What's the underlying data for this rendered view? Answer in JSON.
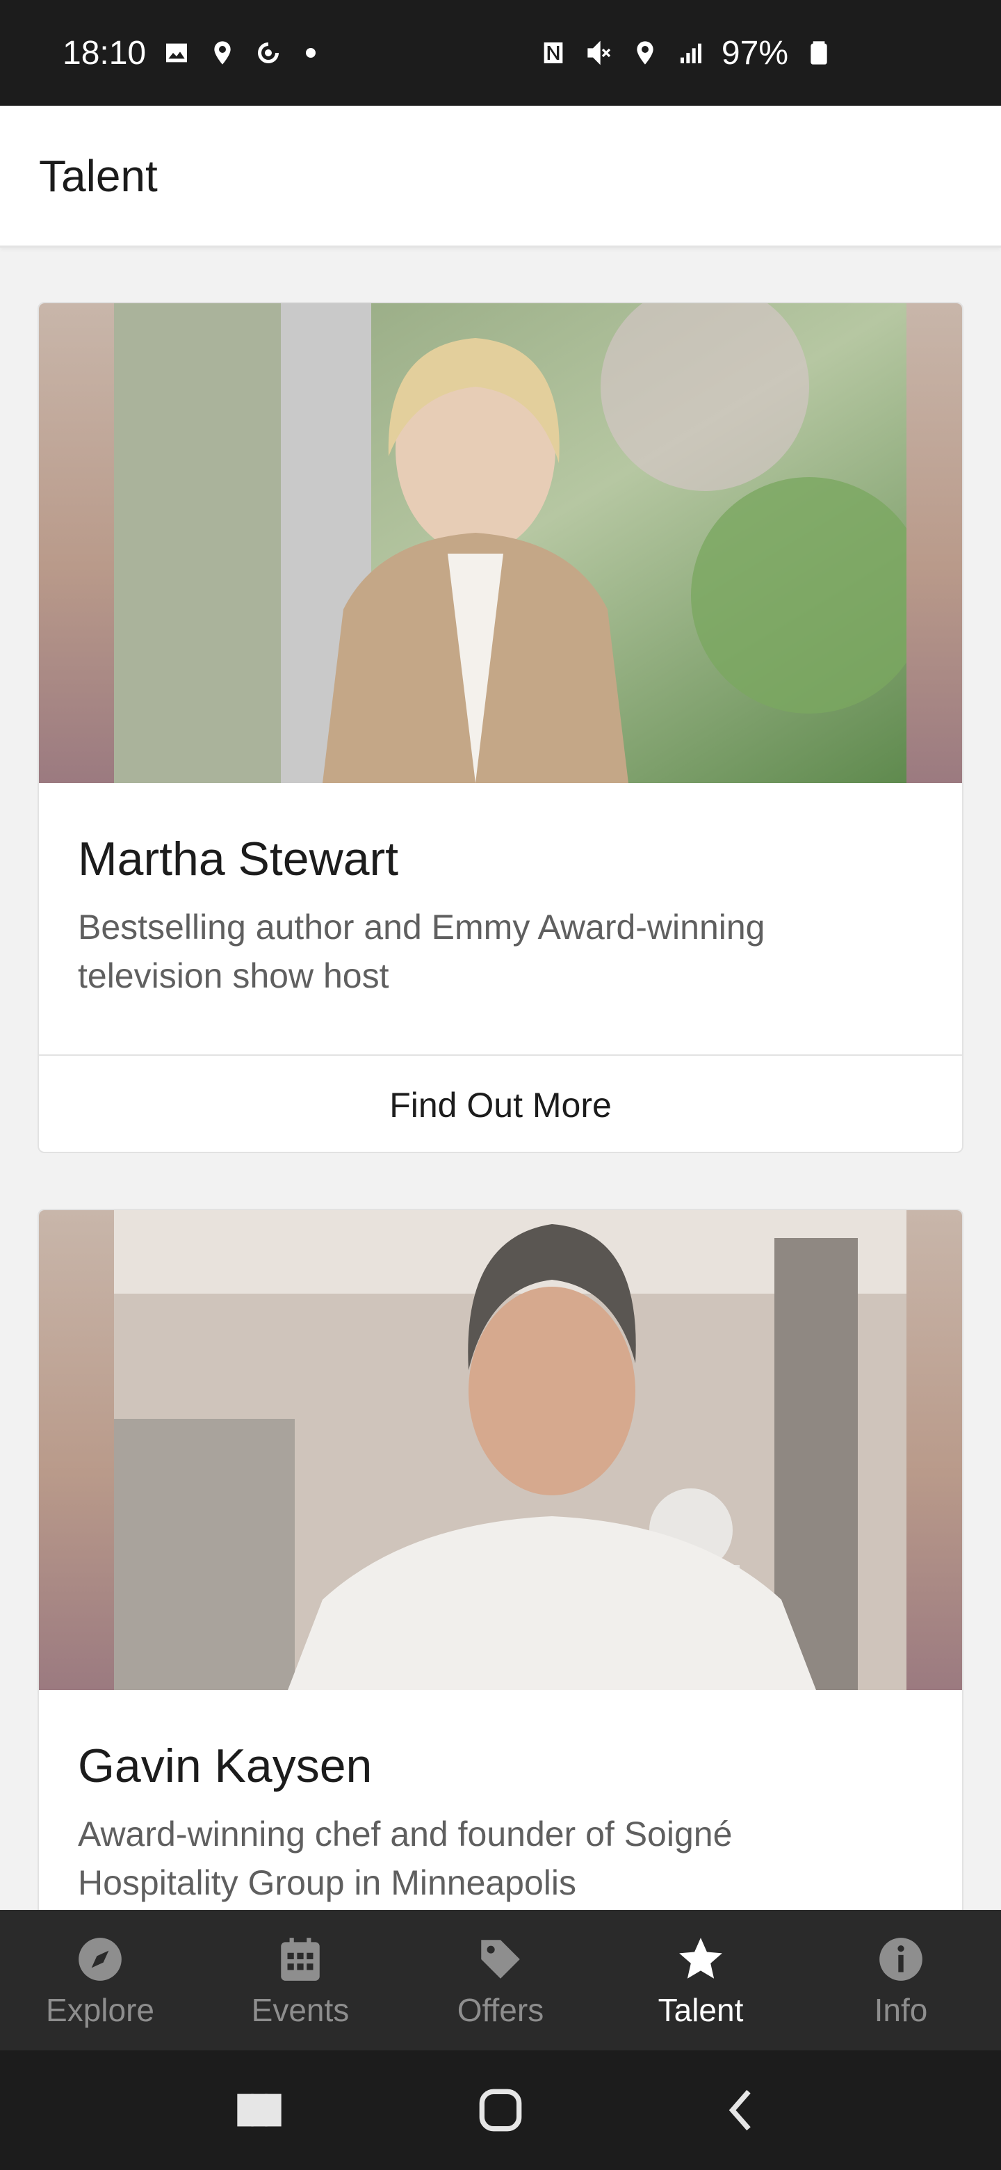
{
  "status_bar": {
    "time": "18:10",
    "battery": "97%",
    "left_icons": [
      "image-icon",
      "location-pin-icon",
      "sync-icon",
      "dot-icon"
    ],
    "right_icons": [
      "nfc-icon",
      "mute-icon",
      "location-icon",
      "signal-icon",
      "battery-icon"
    ]
  },
  "header": {
    "title": "Talent"
  },
  "talent": [
    {
      "name": "Martha Stewart",
      "description": "Bestselling author and Emmy Award-winning television show host",
      "button_label": "Find Out More"
    },
    {
      "name": "Gavin Kaysen",
      "description": "Award-winning chef and founder of Soigné Hospitality Group in Minneapolis"
    }
  ],
  "bottom_nav": {
    "items": [
      {
        "label": "Explore",
        "icon": "compass-icon",
        "active": false
      },
      {
        "label": "Events",
        "icon": "calendar-icon",
        "active": false
      },
      {
        "label": "Offers",
        "icon": "tag-icon",
        "active": false
      },
      {
        "label": "Talent",
        "icon": "star-icon",
        "active": true
      },
      {
        "label": "Info",
        "icon": "info-icon",
        "active": false
      }
    ]
  },
  "system_nav": [
    "recents-button",
    "home-button",
    "back-button"
  ],
  "colors": {
    "nav_background": "#2a2a2a",
    "nav_active": "#ffffff",
    "nav_inactive": "#8e8e8e",
    "status_background": "#1c1c1c"
  }
}
